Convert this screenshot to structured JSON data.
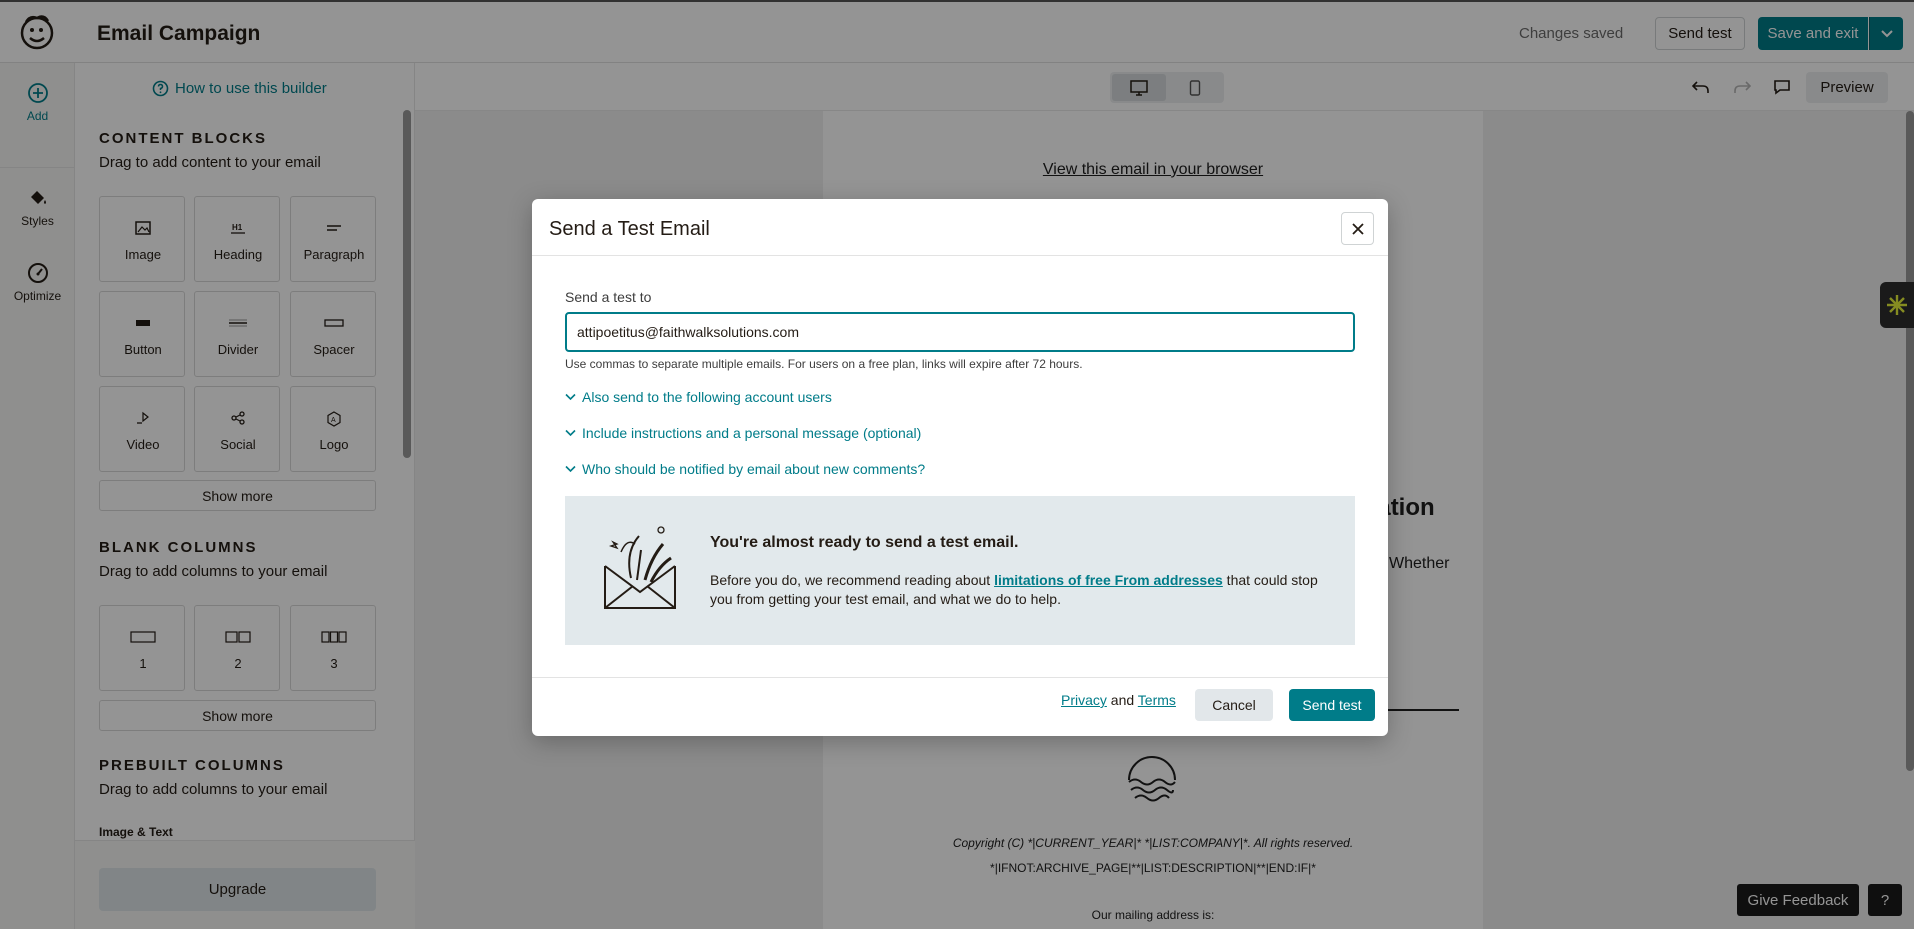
{
  "app": {
    "title": "Email Campaign",
    "status": "Changes saved",
    "send_test_label": "Send test",
    "save_exit_label": "Save and exit"
  },
  "rail": {
    "add_label": "Add",
    "styles_label": "Styles",
    "optimize_label": "Optimize"
  },
  "panel": {
    "howto_label": "How to use this builder",
    "content_blocks": {
      "title": "CONTENT BLOCKS",
      "subtitle": "Drag to add content to your email",
      "tiles": [
        "Image",
        "Heading",
        "Paragraph",
        "Button",
        "Divider",
        "Spacer",
        "Video",
        "Social",
        "Logo"
      ],
      "show_more": "Show more"
    },
    "blank_columns": {
      "title": "BLANK COLUMNS",
      "subtitle": "Drag to add columns to your email",
      "tiles": [
        "1",
        "2",
        "3"
      ],
      "show_more": "Show more"
    },
    "prebuilt_columns": {
      "title": "PREBUILT COLUMNS",
      "subtitle": "Drag to add columns to your email",
      "first_item": "Image & Text"
    },
    "upgrade_label": "Upgrade"
  },
  "canvas": {
    "preview_label": "Preview",
    "view_in_browser": "View this email in your browser",
    "heading_fragment": "ration",
    "text_fragment": "Whether",
    "copyright": "Copyright (C) *|CURRENT_YEAR|* *|LIST:COMPANY|*. All rights reserved.",
    "archive": "*|IFNOT:ARCHIVE_PAGE|**|LIST:DESCRIPTION|**|END:IF|*",
    "mailing": "Our mailing address is:",
    "feedback_label": "Give Feedback",
    "help_label": "?"
  },
  "modal": {
    "title": "Send a Test Email",
    "field_label": "Send a test to",
    "email_value": "attipoetitus@faithwalksolutions.com",
    "helper": "Use commas to separate multiple emails. For users on a free plan, links will expire after 72 hours.",
    "accordions": [
      "Also send to the following account users",
      "Include instructions and a personal message (optional)",
      "Who should be notified by email about new comments?"
    ],
    "notice": {
      "title": "You're almost ready to send a test email.",
      "body_before": "Before you do, we recommend reading about ",
      "link": "limitations of free From addresses",
      "body_after": " that could stop you from getting your test email, and what we do to help."
    },
    "privacy_label": "Privacy",
    "and_label": " and ",
    "terms_label": "Terms",
    "cancel_label": "Cancel",
    "send_label": "Send test"
  },
  "colors": {
    "accent": "#007c89",
    "notice_bg": "#e2e9ec"
  }
}
